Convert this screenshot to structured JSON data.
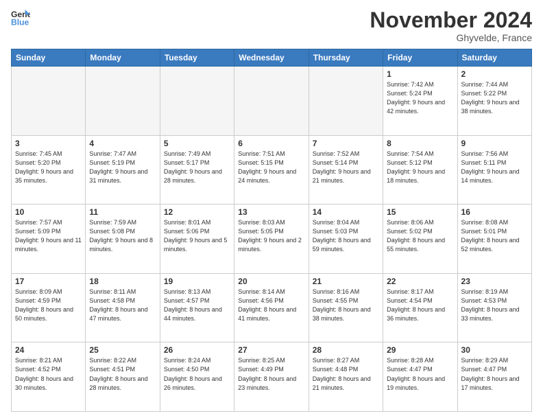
{
  "logo": {
    "line1": "General",
    "line2": "Blue"
  },
  "title": "November 2024",
  "location": "Ghyvelde, France",
  "days_of_week": [
    "Sunday",
    "Monday",
    "Tuesday",
    "Wednesday",
    "Thursday",
    "Friday",
    "Saturday"
  ],
  "weeks": [
    [
      {
        "day": "",
        "info": ""
      },
      {
        "day": "",
        "info": ""
      },
      {
        "day": "",
        "info": ""
      },
      {
        "day": "",
        "info": ""
      },
      {
        "day": "",
        "info": ""
      },
      {
        "day": "1",
        "info": "Sunrise: 7:42 AM\nSunset: 5:24 PM\nDaylight: 9 hours\nand 42 minutes."
      },
      {
        "day": "2",
        "info": "Sunrise: 7:44 AM\nSunset: 5:22 PM\nDaylight: 9 hours\nand 38 minutes."
      }
    ],
    [
      {
        "day": "3",
        "info": "Sunrise: 7:45 AM\nSunset: 5:20 PM\nDaylight: 9 hours\nand 35 minutes."
      },
      {
        "day": "4",
        "info": "Sunrise: 7:47 AM\nSunset: 5:19 PM\nDaylight: 9 hours\nand 31 minutes."
      },
      {
        "day": "5",
        "info": "Sunrise: 7:49 AM\nSunset: 5:17 PM\nDaylight: 9 hours\nand 28 minutes."
      },
      {
        "day": "6",
        "info": "Sunrise: 7:51 AM\nSunset: 5:15 PM\nDaylight: 9 hours\nand 24 minutes."
      },
      {
        "day": "7",
        "info": "Sunrise: 7:52 AM\nSunset: 5:14 PM\nDaylight: 9 hours\nand 21 minutes."
      },
      {
        "day": "8",
        "info": "Sunrise: 7:54 AM\nSunset: 5:12 PM\nDaylight: 9 hours\nand 18 minutes."
      },
      {
        "day": "9",
        "info": "Sunrise: 7:56 AM\nSunset: 5:11 PM\nDaylight: 9 hours\nand 14 minutes."
      }
    ],
    [
      {
        "day": "10",
        "info": "Sunrise: 7:57 AM\nSunset: 5:09 PM\nDaylight: 9 hours\nand 11 minutes."
      },
      {
        "day": "11",
        "info": "Sunrise: 7:59 AM\nSunset: 5:08 PM\nDaylight: 9 hours\nand 8 minutes."
      },
      {
        "day": "12",
        "info": "Sunrise: 8:01 AM\nSunset: 5:06 PM\nDaylight: 9 hours\nand 5 minutes."
      },
      {
        "day": "13",
        "info": "Sunrise: 8:03 AM\nSunset: 5:05 PM\nDaylight: 9 hours\nand 2 minutes."
      },
      {
        "day": "14",
        "info": "Sunrise: 8:04 AM\nSunset: 5:03 PM\nDaylight: 8 hours\nand 59 minutes."
      },
      {
        "day": "15",
        "info": "Sunrise: 8:06 AM\nSunset: 5:02 PM\nDaylight: 8 hours\nand 55 minutes."
      },
      {
        "day": "16",
        "info": "Sunrise: 8:08 AM\nSunset: 5:01 PM\nDaylight: 8 hours\nand 52 minutes."
      }
    ],
    [
      {
        "day": "17",
        "info": "Sunrise: 8:09 AM\nSunset: 4:59 PM\nDaylight: 8 hours\nand 50 minutes."
      },
      {
        "day": "18",
        "info": "Sunrise: 8:11 AM\nSunset: 4:58 PM\nDaylight: 8 hours\nand 47 minutes."
      },
      {
        "day": "19",
        "info": "Sunrise: 8:13 AM\nSunset: 4:57 PM\nDaylight: 8 hours\nand 44 minutes."
      },
      {
        "day": "20",
        "info": "Sunrise: 8:14 AM\nSunset: 4:56 PM\nDaylight: 8 hours\nand 41 minutes."
      },
      {
        "day": "21",
        "info": "Sunrise: 8:16 AM\nSunset: 4:55 PM\nDaylight: 8 hours\nand 38 minutes."
      },
      {
        "day": "22",
        "info": "Sunrise: 8:17 AM\nSunset: 4:54 PM\nDaylight: 8 hours\nand 36 minutes."
      },
      {
        "day": "23",
        "info": "Sunrise: 8:19 AM\nSunset: 4:53 PM\nDaylight: 8 hours\nand 33 minutes."
      }
    ],
    [
      {
        "day": "24",
        "info": "Sunrise: 8:21 AM\nSunset: 4:52 PM\nDaylight: 8 hours\nand 30 minutes."
      },
      {
        "day": "25",
        "info": "Sunrise: 8:22 AM\nSunset: 4:51 PM\nDaylight: 8 hours\nand 28 minutes."
      },
      {
        "day": "26",
        "info": "Sunrise: 8:24 AM\nSunset: 4:50 PM\nDaylight: 8 hours\nand 26 minutes."
      },
      {
        "day": "27",
        "info": "Sunrise: 8:25 AM\nSunset: 4:49 PM\nDaylight: 8 hours\nand 23 minutes."
      },
      {
        "day": "28",
        "info": "Sunrise: 8:27 AM\nSunset: 4:48 PM\nDaylight: 8 hours\nand 21 minutes."
      },
      {
        "day": "29",
        "info": "Sunrise: 8:28 AM\nSunset: 4:47 PM\nDaylight: 8 hours\nand 19 minutes."
      },
      {
        "day": "30",
        "info": "Sunrise: 8:29 AM\nSunset: 4:47 PM\nDaylight: 8 hours\nand 17 minutes."
      }
    ]
  ]
}
